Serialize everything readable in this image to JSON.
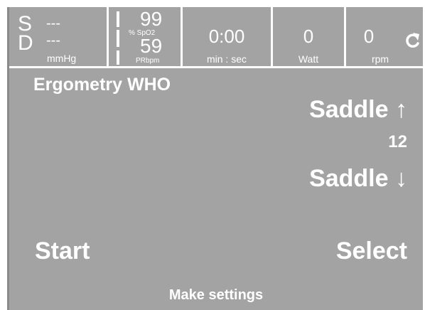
{
  "status": {
    "bp": {
      "systolic_label": "S",
      "systolic_value": "---",
      "diastolic_label": "D",
      "diastolic_value": "---",
      "unit": "mmHg"
    },
    "spo2": {
      "value": "99",
      "unit": "% SpO2"
    },
    "pulse": {
      "value": "59",
      "unit": "PRbpm"
    },
    "time": {
      "value": "0:00",
      "unit": "min : sec"
    },
    "power": {
      "value": "0",
      "unit": "Watt"
    },
    "cadence": {
      "value": "0",
      "unit": "rpm",
      "icon": "rotate-arrow-icon"
    }
  },
  "program": {
    "title": "Ergometry WHO"
  },
  "saddle": {
    "up_label": "Saddle ↑",
    "value": "12",
    "down_label": "Saddle ↓"
  },
  "buttons": {
    "start": "Start",
    "select": "Select"
  },
  "hint": "Make settings",
  "colors": {
    "background": "#a3a3a3",
    "text": "#ffffff"
  }
}
